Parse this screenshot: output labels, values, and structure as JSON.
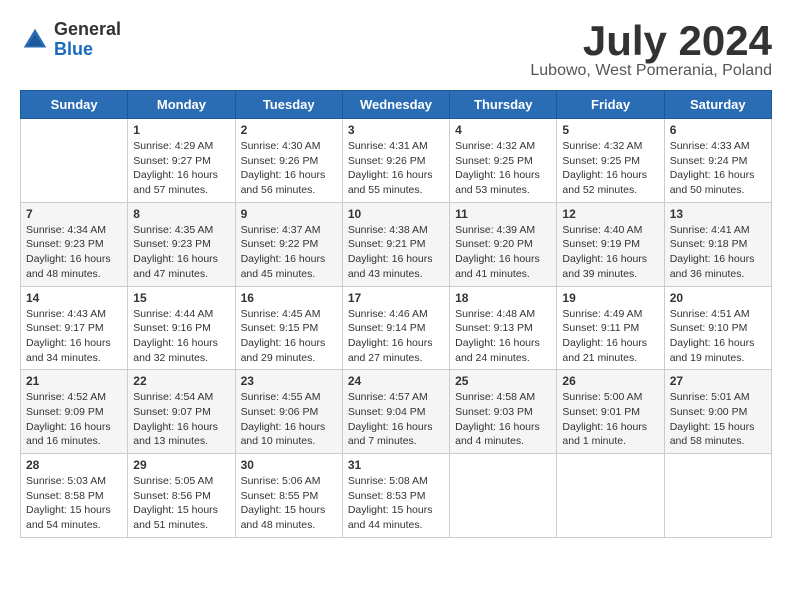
{
  "header": {
    "logo_general": "General",
    "logo_blue": "Blue",
    "month_title": "July 2024",
    "location": "Lubowo, West Pomerania, Poland"
  },
  "days_of_week": [
    "Sunday",
    "Monday",
    "Tuesday",
    "Wednesday",
    "Thursday",
    "Friday",
    "Saturday"
  ],
  "weeks": [
    [
      {
        "day": "",
        "info": ""
      },
      {
        "day": "1",
        "info": "Sunrise: 4:29 AM\nSunset: 9:27 PM\nDaylight: 16 hours\nand 57 minutes."
      },
      {
        "day": "2",
        "info": "Sunrise: 4:30 AM\nSunset: 9:26 PM\nDaylight: 16 hours\nand 56 minutes."
      },
      {
        "day": "3",
        "info": "Sunrise: 4:31 AM\nSunset: 9:26 PM\nDaylight: 16 hours\nand 55 minutes."
      },
      {
        "day": "4",
        "info": "Sunrise: 4:32 AM\nSunset: 9:25 PM\nDaylight: 16 hours\nand 53 minutes."
      },
      {
        "day": "5",
        "info": "Sunrise: 4:32 AM\nSunset: 9:25 PM\nDaylight: 16 hours\nand 52 minutes."
      },
      {
        "day": "6",
        "info": "Sunrise: 4:33 AM\nSunset: 9:24 PM\nDaylight: 16 hours\nand 50 minutes."
      }
    ],
    [
      {
        "day": "7",
        "info": "Sunrise: 4:34 AM\nSunset: 9:23 PM\nDaylight: 16 hours\nand 48 minutes."
      },
      {
        "day": "8",
        "info": "Sunrise: 4:35 AM\nSunset: 9:23 PM\nDaylight: 16 hours\nand 47 minutes."
      },
      {
        "day": "9",
        "info": "Sunrise: 4:37 AM\nSunset: 9:22 PM\nDaylight: 16 hours\nand 45 minutes."
      },
      {
        "day": "10",
        "info": "Sunrise: 4:38 AM\nSunset: 9:21 PM\nDaylight: 16 hours\nand 43 minutes."
      },
      {
        "day": "11",
        "info": "Sunrise: 4:39 AM\nSunset: 9:20 PM\nDaylight: 16 hours\nand 41 minutes."
      },
      {
        "day": "12",
        "info": "Sunrise: 4:40 AM\nSunset: 9:19 PM\nDaylight: 16 hours\nand 39 minutes."
      },
      {
        "day": "13",
        "info": "Sunrise: 4:41 AM\nSunset: 9:18 PM\nDaylight: 16 hours\nand 36 minutes."
      }
    ],
    [
      {
        "day": "14",
        "info": "Sunrise: 4:43 AM\nSunset: 9:17 PM\nDaylight: 16 hours\nand 34 minutes."
      },
      {
        "day": "15",
        "info": "Sunrise: 4:44 AM\nSunset: 9:16 PM\nDaylight: 16 hours\nand 32 minutes."
      },
      {
        "day": "16",
        "info": "Sunrise: 4:45 AM\nSunset: 9:15 PM\nDaylight: 16 hours\nand 29 minutes."
      },
      {
        "day": "17",
        "info": "Sunrise: 4:46 AM\nSunset: 9:14 PM\nDaylight: 16 hours\nand 27 minutes."
      },
      {
        "day": "18",
        "info": "Sunrise: 4:48 AM\nSunset: 9:13 PM\nDaylight: 16 hours\nand 24 minutes."
      },
      {
        "day": "19",
        "info": "Sunrise: 4:49 AM\nSunset: 9:11 PM\nDaylight: 16 hours\nand 21 minutes."
      },
      {
        "day": "20",
        "info": "Sunrise: 4:51 AM\nSunset: 9:10 PM\nDaylight: 16 hours\nand 19 minutes."
      }
    ],
    [
      {
        "day": "21",
        "info": "Sunrise: 4:52 AM\nSunset: 9:09 PM\nDaylight: 16 hours\nand 16 minutes."
      },
      {
        "day": "22",
        "info": "Sunrise: 4:54 AM\nSunset: 9:07 PM\nDaylight: 16 hours\nand 13 minutes."
      },
      {
        "day": "23",
        "info": "Sunrise: 4:55 AM\nSunset: 9:06 PM\nDaylight: 16 hours\nand 10 minutes."
      },
      {
        "day": "24",
        "info": "Sunrise: 4:57 AM\nSunset: 9:04 PM\nDaylight: 16 hours\nand 7 minutes."
      },
      {
        "day": "25",
        "info": "Sunrise: 4:58 AM\nSunset: 9:03 PM\nDaylight: 16 hours\nand 4 minutes."
      },
      {
        "day": "26",
        "info": "Sunrise: 5:00 AM\nSunset: 9:01 PM\nDaylight: 16 hours\nand 1 minute."
      },
      {
        "day": "27",
        "info": "Sunrise: 5:01 AM\nSunset: 9:00 PM\nDaylight: 15 hours\nand 58 minutes."
      }
    ],
    [
      {
        "day": "28",
        "info": "Sunrise: 5:03 AM\nSunset: 8:58 PM\nDaylight: 15 hours\nand 54 minutes."
      },
      {
        "day": "29",
        "info": "Sunrise: 5:05 AM\nSunset: 8:56 PM\nDaylight: 15 hours\nand 51 minutes."
      },
      {
        "day": "30",
        "info": "Sunrise: 5:06 AM\nSunset: 8:55 PM\nDaylight: 15 hours\nand 48 minutes."
      },
      {
        "day": "31",
        "info": "Sunrise: 5:08 AM\nSunset: 8:53 PM\nDaylight: 15 hours\nand 44 minutes."
      },
      {
        "day": "",
        "info": ""
      },
      {
        "day": "",
        "info": ""
      },
      {
        "day": "",
        "info": ""
      }
    ]
  ]
}
